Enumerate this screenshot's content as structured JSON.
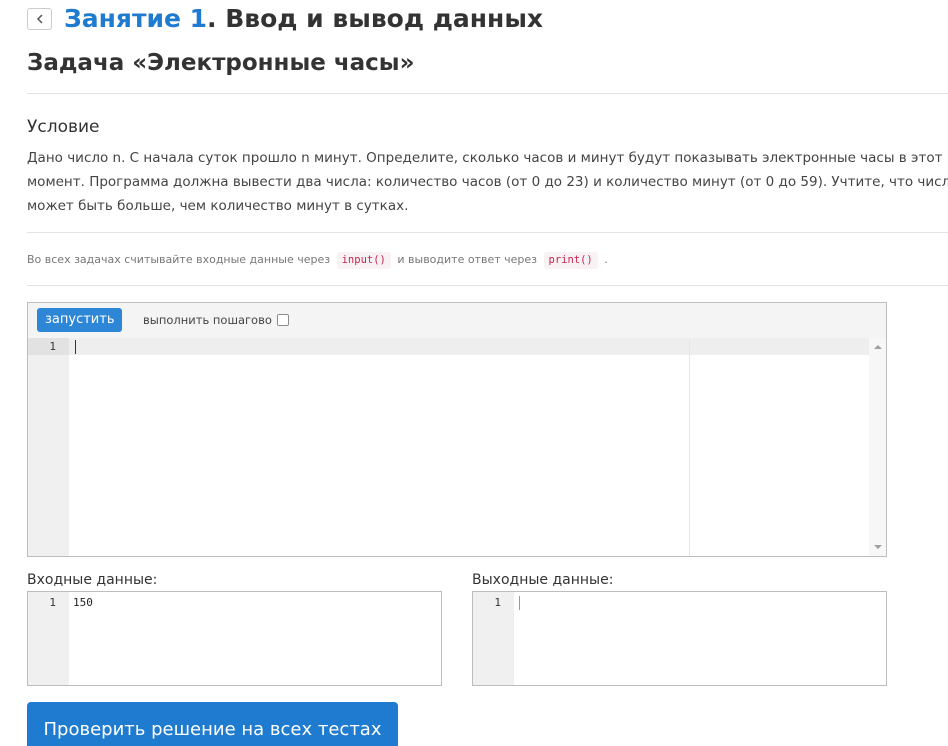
{
  "header": {
    "back_icon": "chevron-left-icon",
    "lesson_link": "Занятие 1",
    "lesson_rest": ". Ввод и вывод данных"
  },
  "task": {
    "title": "Задача «Электронные часы»",
    "condition_heading": "Условие",
    "condition_text": "Дано число n. С начала суток прошло n минут. Определите, сколько часов и минут будут показывать электронные часы в этот момент. Программа должна вывести два числа: количество часов (от 0 до 23) и количество минут (от 0 до 59). Учтите, что число n может быть больше, чем количество минут в сутках."
  },
  "hint": {
    "before": "Во всех задачах считывайте входные данные через",
    "input_code": "input()",
    "middle": "и выводите ответ через",
    "print_code": "print()",
    "after": "."
  },
  "editor": {
    "run_label": "запустить",
    "step_label": "выполнить пошагово",
    "step_checked": false,
    "line_number": "1",
    "code": ""
  },
  "input_panel": {
    "label": "Входные данные:",
    "line_number": "1",
    "value": "150"
  },
  "output_panel": {
    "label": "Выходные данные:",
    "line_number": "1",
    "value": ""
  },
  "check_button": {
    "label": "Проверить решение на всех тестах"
  },
  "colors": {
    "accent": "#1f7bd0",
    "run_button": "#2e87d6",
    "code_chip_text": "#c7254e",
    "code_chip_bg": "#f9f2f4"
  }
}
